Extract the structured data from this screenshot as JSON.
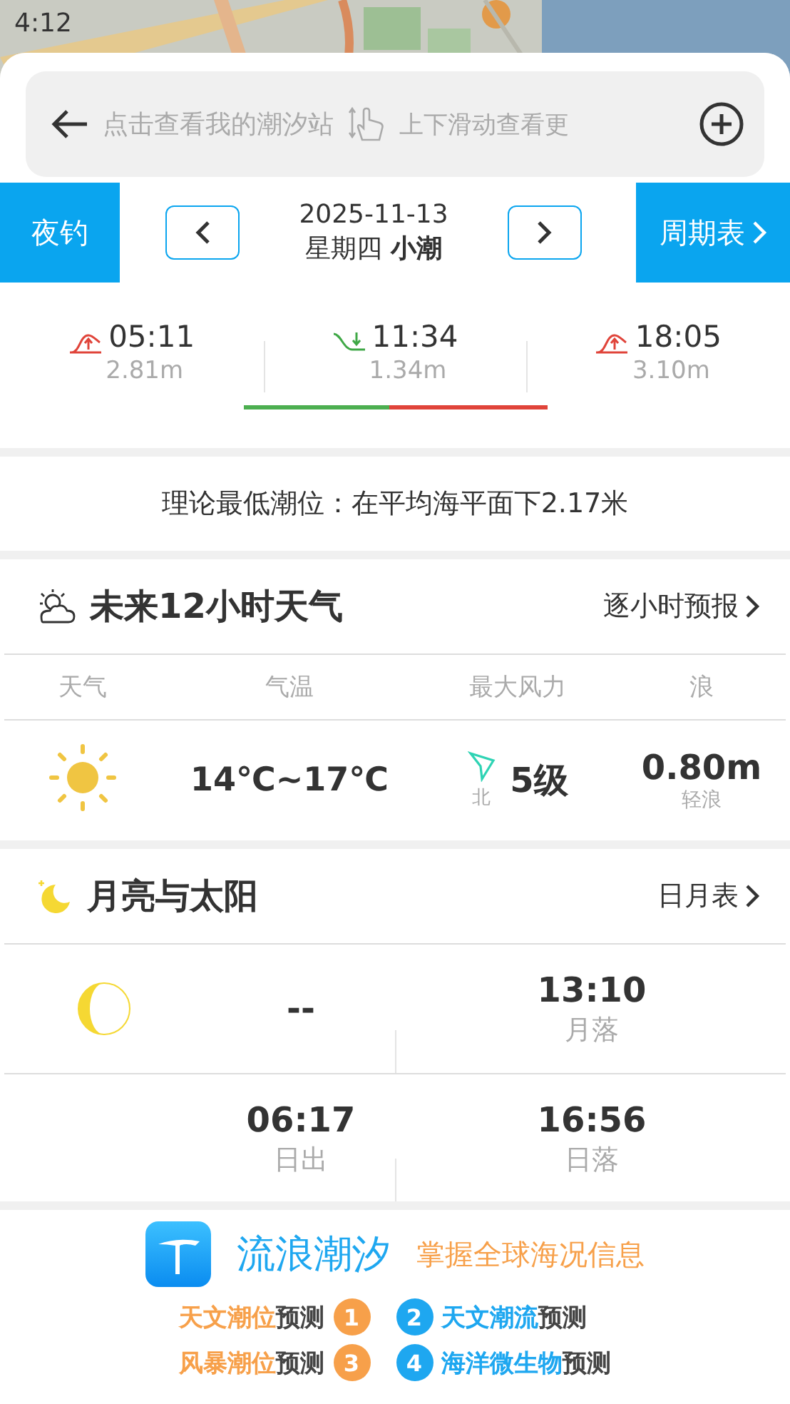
{
  "status_bar": {
    "time": "4:12"
  },
  "search": {
    "placeholder": "点击查看我的潮汐站",
    "hint": "上下滑动查看更"
  },
  "date_bar": {
    "left_button": "夜钓",
    "date": "2025-11-13",
    "weekday": "星期四",
    "tide_type": "小潮",
    "right_button": "周期表"
  },
  "tides": [
    {
      "kind": "high",
      "time": "05:11",
      "height": "2.81m"
    },
    {
      "kind": "low",
      "time": "11:34",
      "height": "1.34m"
    },
    {
      "kind": "high",
      "time": "18:05",
      "height": "3.10m"
    }
  ],
  "tide_progress": {
    "level": 0.48
  },
  "lowest_tide": "理论最低潮位：在平均海平面下2.17米",
  "weather": {
    "title": "未来12小时天气",
    "link": "逐小时预报",
    "columns": [
      "天气",
      "气温",
      "最大风力",
      "浪"
    ],
    "temperature": "14℃~17℃",
    "wind_direction": "北",
    "wind_level": "5级",
    "wave_height": "0.80m",
    "wave_desc": "轻浪"
  },
  "moon_sun": {
    "title": "月亮与太阳",
    "link": "日月表",
    "moonrise": "--",
    "moonset_time": "13:10",
    "moonset_label": "月落",
    "sunrise_time": "06:17",
    "sunrise_label": "日出",
    "sunset_time": "16:56",
    "sunset_label": "日落"
  },
  "banner": {
    "app_name": "流浪潮汐",
    "slogan": "掌握全球海况信息",
    "features": [
      {
        "number": "1",
        "highlight": "天文潮位",
        "rest": "预测",
        "color": "#f7a04a"
      },
      {
        "number": "2",
        "highlight": "天文潮流",
        "rest": "预测",
        "color": "#1ea7f0"
      },
      {
        "number": "3",
        "highlight": "风暴潮位",
        "rest": "预测",
        "color": "#f7a04a"
      },
      {
        "number": "4",
        "highlight": "海洋微生物",
        "rest": "预测",
        "color": "#1ea7f0"
      }
    ]
  }
}
